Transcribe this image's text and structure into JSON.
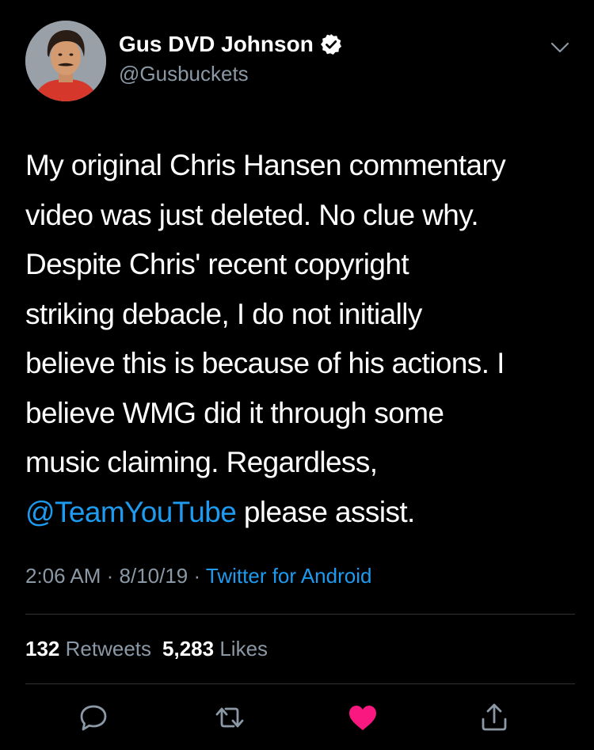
{
  "author": {
    "display_name": "Gus DVD Johnson",
    "handle": "@Gusbuckets",
    "verified": true
  },
  "tweet": {
    "lines": [
      "My original Chris Hansen commentary",
      "video was just deleted. No clue why.",
      "Despite Chris' recent copyright",
      "striking debacle, I do not initially",
      "believe this is because of his actions. I",
      "believe WMG did it through some",
      "music claiming. Regardless,"
    ],
    "last_line_mention": "@TeamYouTube",
    "last_line_rest": " please assist."
  },
  "meta": {
    "time": "2:06 AM",
    "sep1": " · ",
    "date": "8/10/19",
    "sep2": " · ",
    "source": "Twitter for Android"
  },
  "stats": {
    "retweets_count": "132",
    "retweets_label": "Retweets",
    "likes_count": "5,283",
    "likes_label": "Likes"
  },
  "actions": {
    "reply_icon": "reply-icon",
    "retweet_icon": "retweet-icon",
    "like_icon": "heart-icon",
    "share_icon": "share-icon"
  },
  "colors": {
    "background": "#000000",
    "link": "#1d9bf0",
    "secondary_text": "#8b98a5",
    "like": "#f91880",
    "divider": "#2f3336"
  }
}
